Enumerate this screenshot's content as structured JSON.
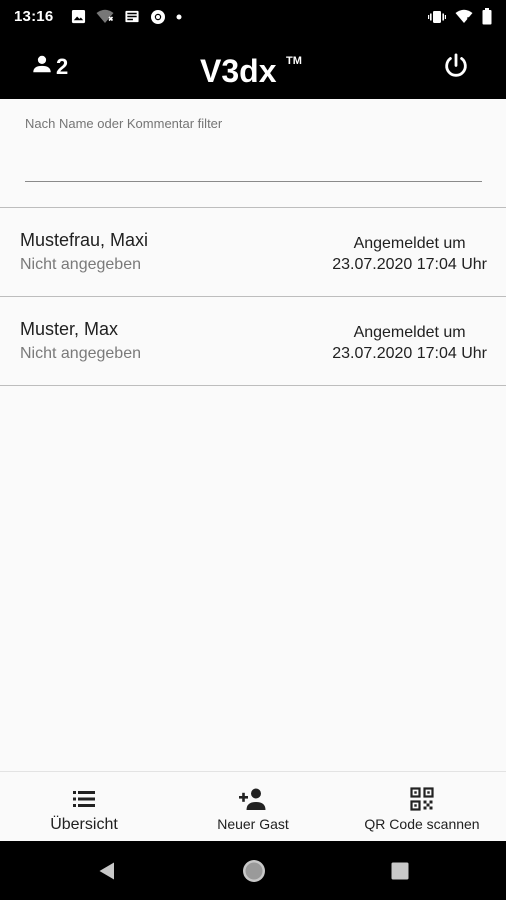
{
  "status_bar": {
    "time": "13:16",
    "left_icons": [
      "image-icon",
      "wifi-off-icon",
      "news-icon",
      "chrome-icon",
      "dot-icon"
    ],
    "right_icons": [
      "vibrate-icon",
      "wifi-icon",
      "battery-icon"
    ]
  },
  "app_bar": {
    "user_count": "2",
    "logo_text": "V3dx",
    "logo_tm": "TM"
  },
  "filter": {
    "label": "Nach Name oder Kommentar filter",
    "value": ""
  },
  "guests": [
    {
      "name": "Mustefrau, Maxi",
      "comment": "Nicht angegeben",
      "status_line1": "Angemeldet um",
      "status_line2": "23.07.2020 17:04 Uhr"
    },
    {
      "name": "Muster, Max",
      "comment": "Nicht angegeben",
      "status_line1": "Angemeldet um",
      "status_line2": "23.07.2020 17:04 Uhr"
    }
  ],
  "bottom_nav": {
    "overview": "Übersicht",
    "new_guest": "Neuer Gast",
    "qr_scan": "QR Code scannen"
  },
  "colors": {
    "bar": "#000000",
    "background": "#fafafa",
    "secondary_text": "#7a7a7a"
  }
}
